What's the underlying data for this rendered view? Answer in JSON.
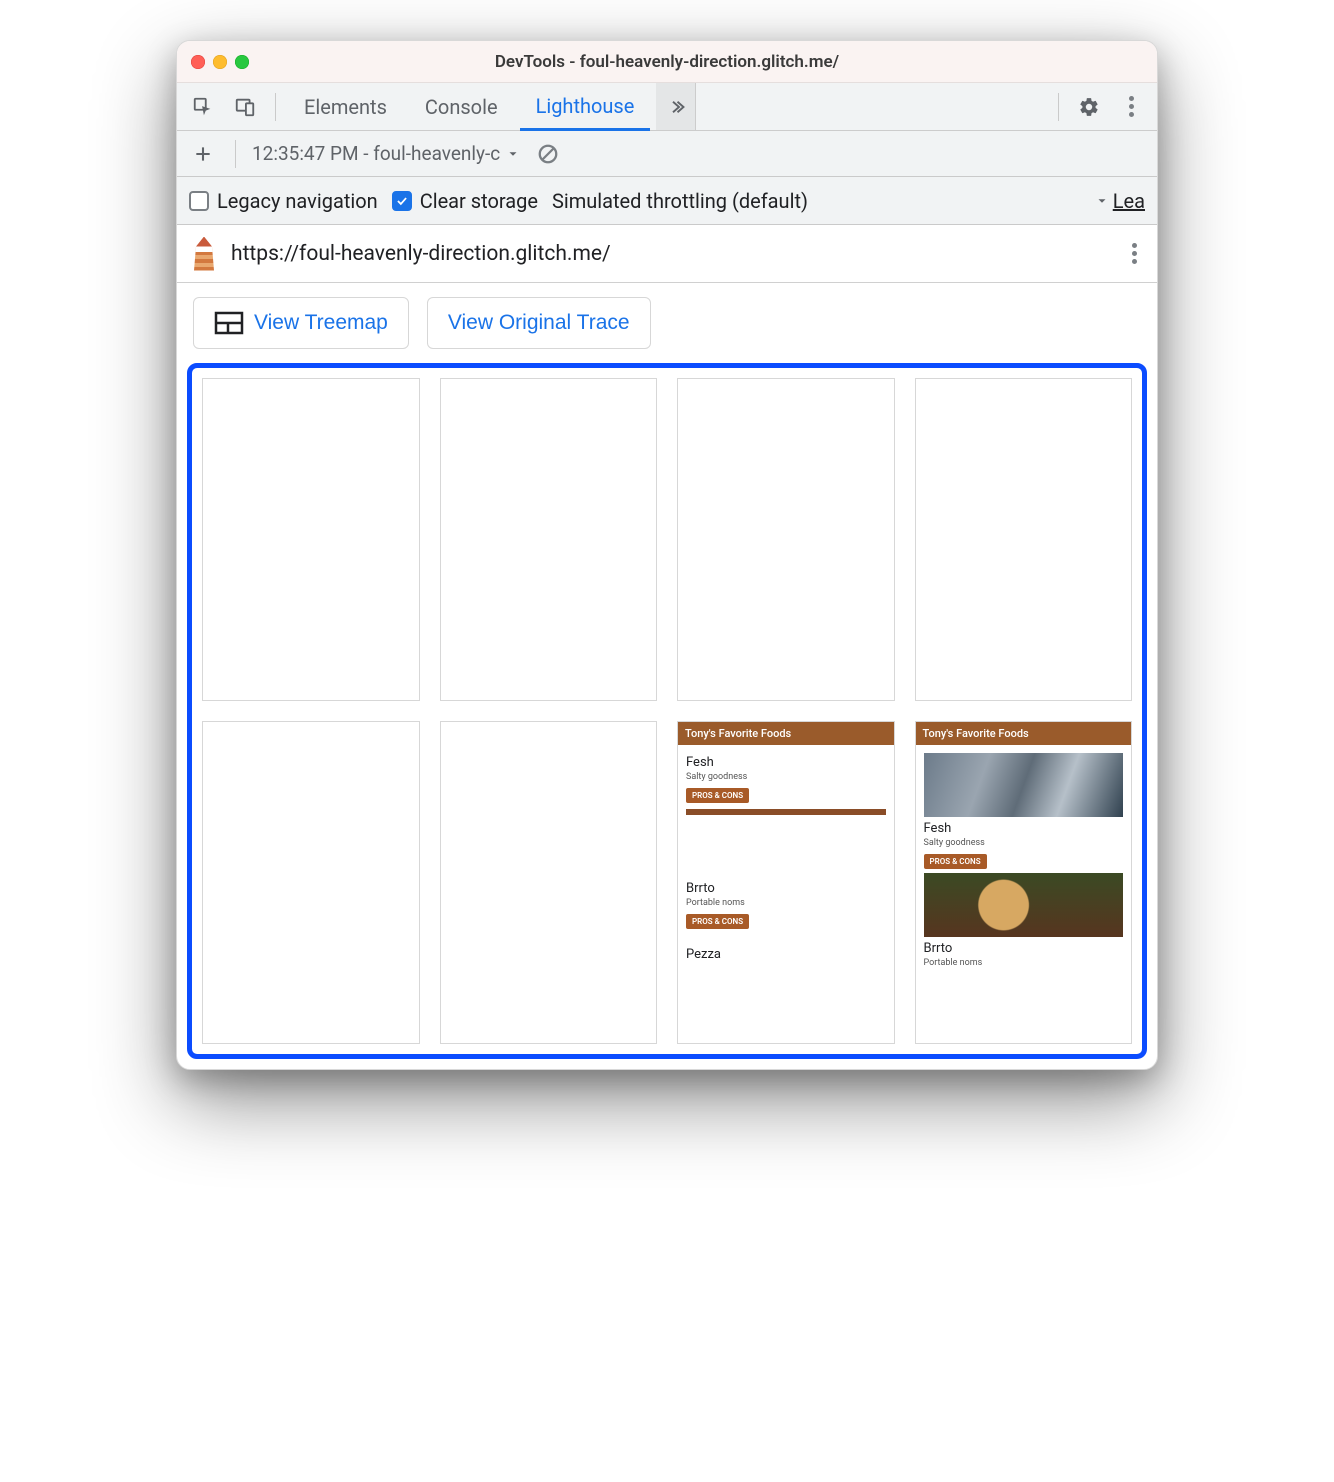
{
  "window": {
    "title": "DevTools - foul-heavenly-direction.glitch.me/"
  },
  "tabs": {
    "elements": "Elements",
    "console": "Console",
    "lighthouse": "Lighthouse"
  },
  "report_dropdown": "12:35:47 PM - foul-heavenly-c",
  "options": {
    "legacy_nav": "Legacy navigation",
    "clear_storage": "Clear storage",
    "throttling": "Simulated throttling (default)",
    "lea": "Lea"
  },
  "url": "https://foul-heavenly-direction.glitch.me/",
  "actions": {
    "view_treemap": "View Treemap",
    "view_trace": "View Original Trace"
  },
  "filmstrip": {
    "site_title": "Tony's Favorite Foods",
    "items": [
      {
        "title": "Fesh",
        "sub": "Salty goodness",
        "btn": "PROS & CONS"
      },
      {
        "title": "Brrto",
        "sub": "Portable noms",
        "btn": "PROS & CONS"
      },
      {
        "title": "Pezza",
        "sub": "",
        "btn": ""
      }
    ]
  }
}
